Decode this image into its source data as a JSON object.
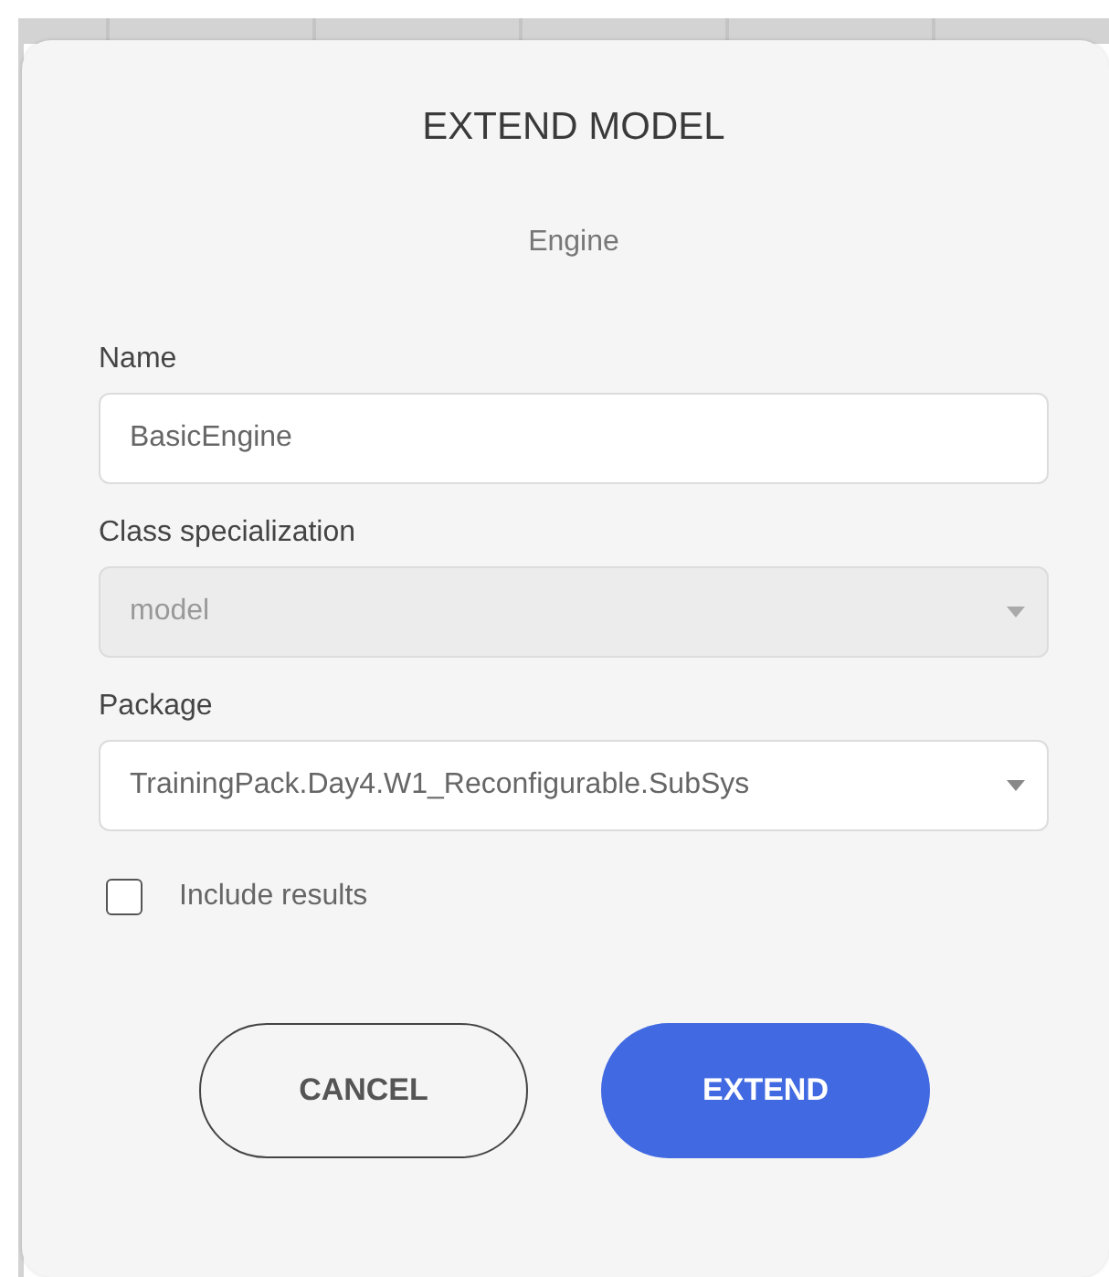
{
  "dialog": {
    "title": "EXTEND MODEL",
    "subtitle": "Engine",
    "fields": [
      {
        "kind": "text",
        "label": "Name",
        "value": "BasicEngine",
        "disabled": false
      },
      {
        "kind": "select",
        "label": "Class specialization",
        "value": "model",
        "disabled": true
      },
      {
        "kind": "select",
        "label": "Package",
        "value": "TrainingPack.Day4.W1_Reconfigurable.SubSys",
        "disabled": false
      }
    ],
    "checkbox": {
      "label": "Include results",
      "checked": false
    },
    "buttons": [
      {
        "label": "CANCEL",
        "kind": "secondary"
      },
      {
        "label": "EXTEND",
        "kind": "primary"
      }
    ]
  }
}
